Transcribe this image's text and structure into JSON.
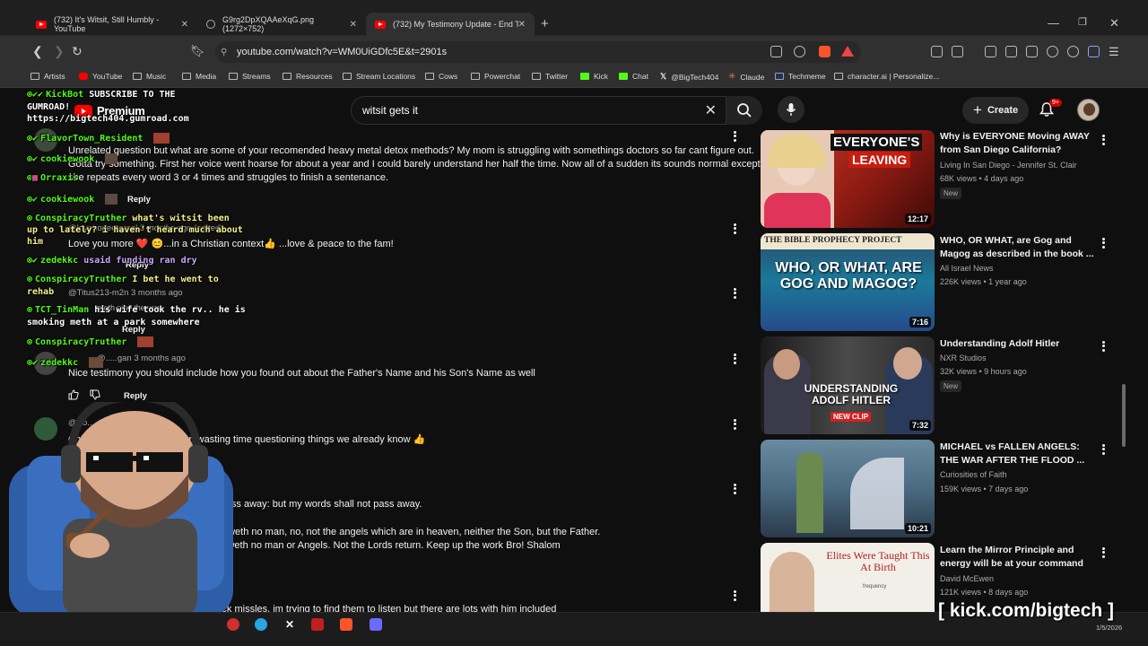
{
  "tabs": [
    {
      "label": "(732) It's Witsit, Still Humbly - YouTube",
      "icon": "youtube-icon"
    },
    {
      "label": "G9rg2DpXQAAeXqG.png (1272×752)",
      "icon": "image-icon"
    },
    {
      "label": "(732) My Testimony Update - End Time",
      "icon": "youtube-icon"
    }
  ],
  "address_bar": {
    "url": "youtube.com/watch?v=WM0UiGDfc5E&t=2901s"
  },
  "bookmarks": [
    "Artists",
    "YouTube",
    "Music",
    "Media",
    "Streams",
    "Resources",
    "Stream Locations",
    "Cows",
    "Powerchat",
    "Twitter",
    "Kick",
    "Chat",
    "@BigTech404",
    "Claude",
    "Techmeme",
    "character.ai | Personalize..."
  ],
  "header": {
    "brand": "Premium",
    "search_value": "witsit gets it",
    "create_label": "Create",
    "notification_badge": "9+"
  },
  "comments": {
    "c1_line1": "Unrelated question but what are some of your recomended heavy metal detox methods? My mom is struggling with somethings doctors so far cant figure out.",
    "c1_line2": "Gotta try something. First her voice went hoarse for about a year and I could barely understand her half the time. Now all of a sudden its sounds normal except",
    "c1_line3": "she repeats every word 3 or 4 times and struggles to finish a sentenance.",
    "c1_reply": "Reply",
    "c2_meta": "@lovehopeeternal 3 months ago (edited)",
    "c2_text": "Love you more ❤️ 😊...in a Christian context👍 ...love & peace to the fam!",
    "c2_reply": "Reply",
    "c3_meta": "@Titus213-m2n 3 months ago",
    "c3_text": "meth ain't the way",
    "c3_reply": "Reply",
    "c4_meta": "@.....gan 3 months ago",
    "c4_text": "Nice testimony you should include how you found out about the Father's Name and his Son's Name as well",
    "c4_reply": "Reply",
    "c5_meta": "@Po.... 3 months ago",
    "c5_text": "Ch.... much better listen than wasting time questioning things we already know 👍",
    "c6_text": "shall pass away: but my words shall not pass away.",
    "c7_line1": "...t hour knoweth no man, no, not the angels which are in heaven, neither the Son, but the Father.",
    "c7_line2": "...y knoweth no man or Angels.  Not the Lords return.  Keep up the work Bro!  Shalom",
    "c8_text": "...buck missles, im trying to find them to listen but there are lots with him included"
  },
  "chat": [
    {
      "user": "KickBot",
      "msg": "SUBSCRIBE TO THE",
      "cont": "GUMROAD!",
      "cont2": "https://bigtech404.gumroad.com",
      "color": "#53fc18"
    },
    {
      "user": "FlavorTown_Resident",
      "msg": "",
      "color": "#53fc18"
    },
    {
      "user": "cookiewook",
      "msg": "",
      "color": "#53fc18"
    },
    {
      "user": "Orraxis",
      "msg": "",
      "color": "#53fc18"
    },
    {
      "user": "cookiewook",
      "msg": "",
      "color": "#53fc18"
    },
    {
      "user": "ConspiracyTruther",
      "msg": "what's witsit been",
      "cont": "up to lately? i haven't heard much about",
      "cont2": "him",
      "color": "#53fc18"
    },
    {
      "user": "zedekkc",
      "msg": "usaid funding ran dry",
      "color": "#53fc18"
    },
    {
      "user": "ConspiracyTruther",
      "msg": "I bet he went to",
      "cont": "rehab",
      "color": "#53fc18"
    },
    {
      "user": "TCT_TinMan",
      "msg": "his wife took the rv.. he is",
      "cont": "smoking meth at a park somewhere",
      "color": "#53fc18"
    },
    {
      "user": "ConspiracyTruther",
      "msg": "",
      "color": "#53fc18"
    },
    {
      "user": "zedekkc",
      "msg": "",
      "color": "#53fc18"
    }
  ],
  "sidebar": [
    {
      "title": "Why is EVERYONE Moving AWAY from San Diego California?",
      "channel": "Living In San Diego - Jennifer St. Clair",
      "stats": "68K views • 4 days ago",
      "badge": "New",
      "duration": "12:17",
      "thumb_text": "EVERYONE'S",
      "thumb_text2": "LEAVING"
    },
    {
      "title": "WHO, OR WHAT, are Gog and Magog as described in the book ...",
      "channel": "All Israel News",
      "stats": "226K views • 1 year ago",
      "badge": "",
      "duration": "7:16",
      "thumb_text": "THE BIBLE PROPHECY PROJECT",
      "thumb_text2": "WHO, OR WHAT, ARE GOG AND MAGOG?"
    },
    {
      "title": "Understanding Adolf Hitler",
      "channel": "NXR Studios",
      "stats": "32K views • 9 hours ago",
      "badge": "New",
      "duration": "7:32",
      "thumb_text": "UNDERSTANDING ADOLF HITLER",
      "thumb_text2": "NEW CLIP"
    },
    {
      "title": "MICHAEL vs FALLEN ANGELS: THE WAR AFTER THE FLOOD ...",
      "channel": "Curiosities of Faith",
      "stats": "159K views • 7 days ago",
      "badge": "",
      "duration": "10:21",
      "thumb_text": "",
      "thumb_text2": ""
    },
    {
      "title": "Learn the Mirror Principle and energy will be at your command",
      "channel": "David McEwen",
      "stats": "121K views • 8 days ago",
      "badge": "",
      "duration": "",
      "thumb_text": "Elites Were Taught This At Birth",
      "thumb_text2": "frequency"
    }
  ],
  "watermark": "[ kick.com/bigtech ]",
  "clock": "1/5/2026"
}
